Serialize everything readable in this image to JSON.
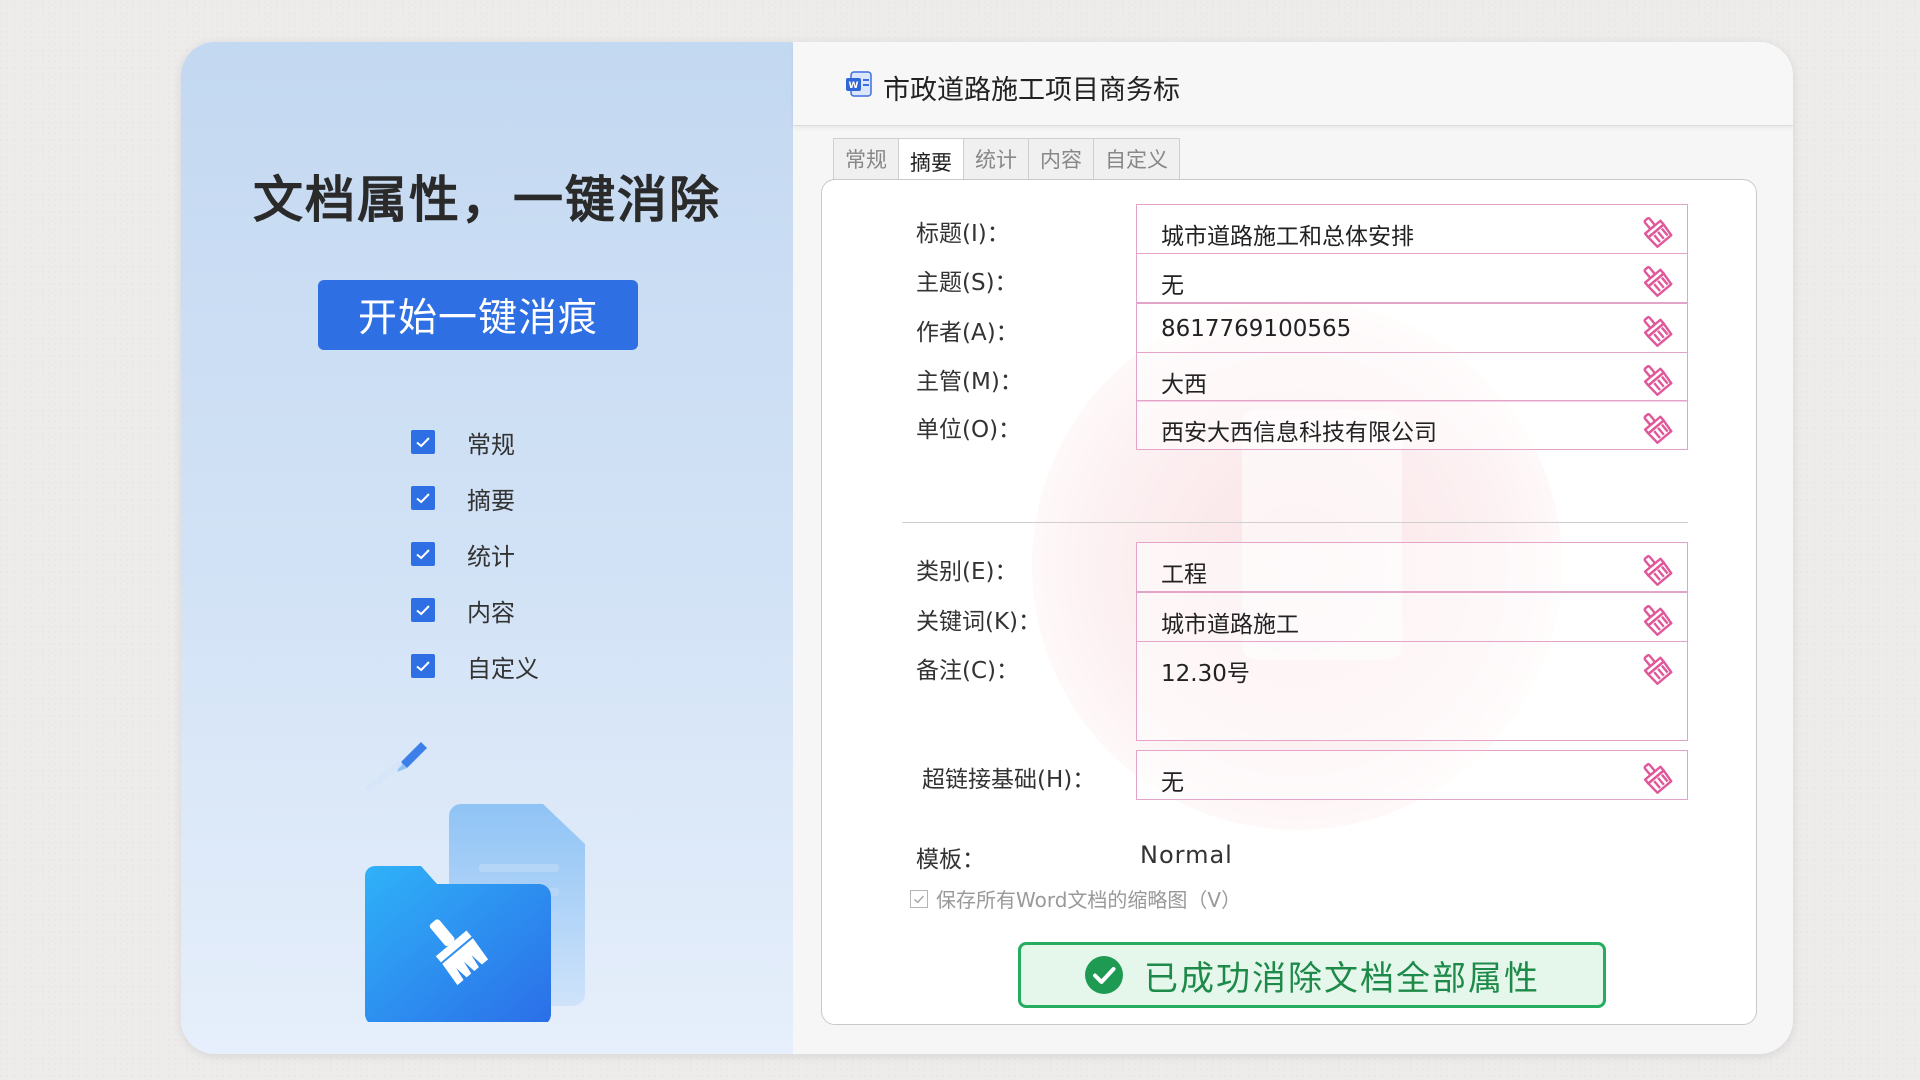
{
  "left": {
    "headline": "文档属性，一键消除",
    "start_button": "开始一键消痕",
    "checks": [
      {
        "label": "常规",
        "checked": true
      },
      {
        "label": "摘要",
        "checked": true
      },
      {
        "label": "统计",
        "checked": true
      },
      {
        "label": "内容",
        "checked": true
      },
      {
        "label": "自定义",
        "checked": true
      }
    ]
  },
  "window": {
    "title": "市政道路施工项目商务标",
    "tabs": [
      "常规",
      "摘要",
      "统计",
      "内容",
      "自定义"
    ],
    "active_tab": "摘要"
  },
  "fields": {
    "title": {
      "label": "标题(I)：",
      "value": "城市道路施工和总体安排"
    },
    "subject": {
      "label": "主题(S)：",
      "value": "无"
    },
    "author": {
      "label": "作者(A)：",
      "value": "8617769100565"
    },
    "manager": {
      "label": "主管(M)：",
      "value": "大西"
    },
    "company": {
      "label": "单位(O)：",
      "value": "西安大西信息科技有限公司"
    },
    "category": {
      "label": "类别(E)：",
      "value": "工程"
    },
    "keywords": {
      "label": "关键词(K)：",
      "value": "城市道路施工"
    },
    "comments": {
      "label": "备注(C)：",
      "value": "12.30号"
    },
    "hyperlink_base": {
      "label": "超链接基础(H)：",
      "value": "无"
    }
  },
  "template": {
    "label": "模板：",
    "value": "Normal"
  },
  "thumbnail_option": {
    "label": "保存所有Word文档的缩略图（V）",
    "checked": true
  },
  "status": {
    "message": "已成功消除文档全部属性",
    "color": "#27ad60"
  },
  "colors": {
    "accent": "#2f6fe4",
    "field_border": "#e4a3c8",
    "broom": "#e0579a"
  }
}
